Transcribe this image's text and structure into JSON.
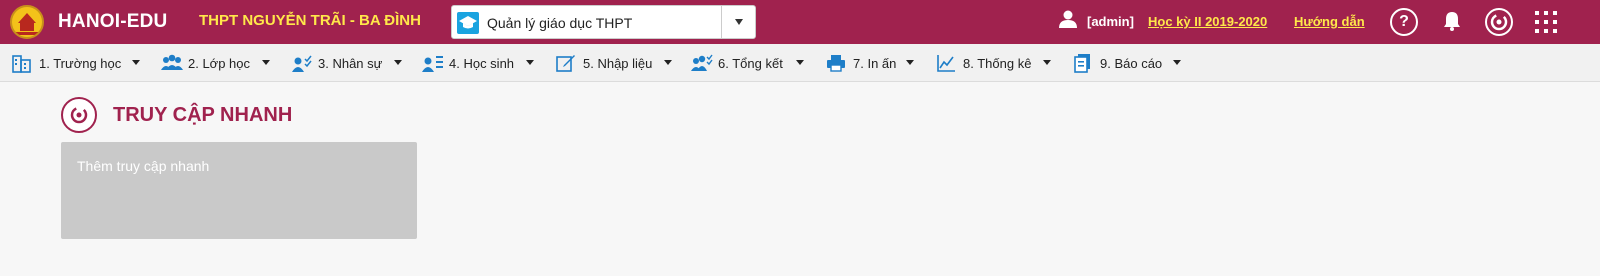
{
  "header": {
    "app_name": "HANOI-EDU",
    "school_name": "THPT NGUYỄN TRÃI - BA ĐÌNH",
    "module_select": {
      "selected": "Quản lý giáo dục THPT"
    },
    "user": "[admin]",
    "semester": "Học kỳ II 2019-2020",
    "help_link": "Hướng dẫn",
    "help_symbol": "?",
    "background_color": "#a0224e",
    "accent_color": "#ffe84a"
  },
  "menu": {
    "items": [
      {
        "label": "1. Trường học",
        "icon": "school-building-icon"
      },
      {
        "label": "2. Lớp học",
        "icon": "class-group-icon"
      },
      {
        "label": "3. Nhân sự",
        "icon": "staff-icon"
      },
      {
        "label": "4. Học sinh",
        "icon": "student-list-icon"
      },
      {
        "label": "5. Nhập liệu",
        "icon": "edit-icon"
      },
      {
        "label": "6. Tổng kết",
        "icon": "summary-icon"
      },
      {
        "label": "7. In ấn",
        "icon": "print-icon"
      },
      {
        "label": "8. Thống kê",
        "icon": "chart-icon"
      },
      {
        "label": "9. Báo cáo",
        "icon": "report-icon"
      }
    ]
  },
  "quick_access": {
    "title": "TRUY CẬP NHANH",
    "add_tile_label": "Thêm truy cập nhanh"
  }
}
